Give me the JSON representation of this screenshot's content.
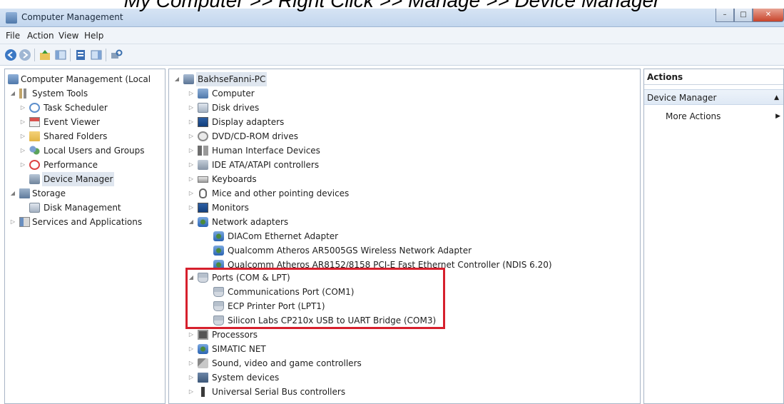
{
  "caption": "My Computer >> Right Click >> Manage >> Device Manager",
  "window": {
    "title": "Computer Management"
  },
  "menu": [
    "File",
    "Action",
    "View",
    "Help"
  ],
  "toolbar": {
    "icons": [
      "back-icon",
      "forward-icon",
      "up-folder-icon",
      "show-hide-tree-icon",
      "properties-icon",
      "help-icon",
      "show-hide-action-pane-icon",
      "scan-hardware-icon"
    ]
  },
  "left_tree": [
    "Computer Management (Local",
    "System Tools",
    "Task Scheduler",
    "Event Viewer",
    "Shared Folders",
    "Local Users and Groups",
    "Performance",
    "Device Manager",
    "Storage",
    "Disk Management",
    "Services and Applications"
  ],
  "device_tree": {
    "root": "BakhseFanni-PC",
    "items": [
      "Computer",
      "Disk drives",
      "Display adapters",
      "DVD/CD-ROM drives",
      "Human Interface Devices",
      "IDE ATA/ATAPI controllers",
      "Keyboards",
      "Mice and other pointing devices",
      "Monitors",
      "Network adapters",
      "DIACom Ethernet Adapter",
      "Qualcomm Atheros AR5005GS Wireless Network Adapter",
      "Qualcomm Atheros AR8152/8158 PCI-E Fast Ethernet Controller (NDIS 6.20)",
      "Ports (COM & LPT)",
      "Communications Port (COM1)",
      "ECP Printer Port (LPT1)",
      "Silicon Labs CP210x USB to UART Bridge (COM3)",
      "Processors",
      "SIMATIC NET",
      "Sound, video and game controllers",
      "System devices",
      "Universal Serial Bus controllers"
    ]
  },
  "actions": {
    "header": "Actions",
    "section": "Device Manager",
    "more": "More Actions"
  },
  "colors": {
    "highlight_box": "#d6202d",
    "selection": "#dfe6ef"
  }
}
